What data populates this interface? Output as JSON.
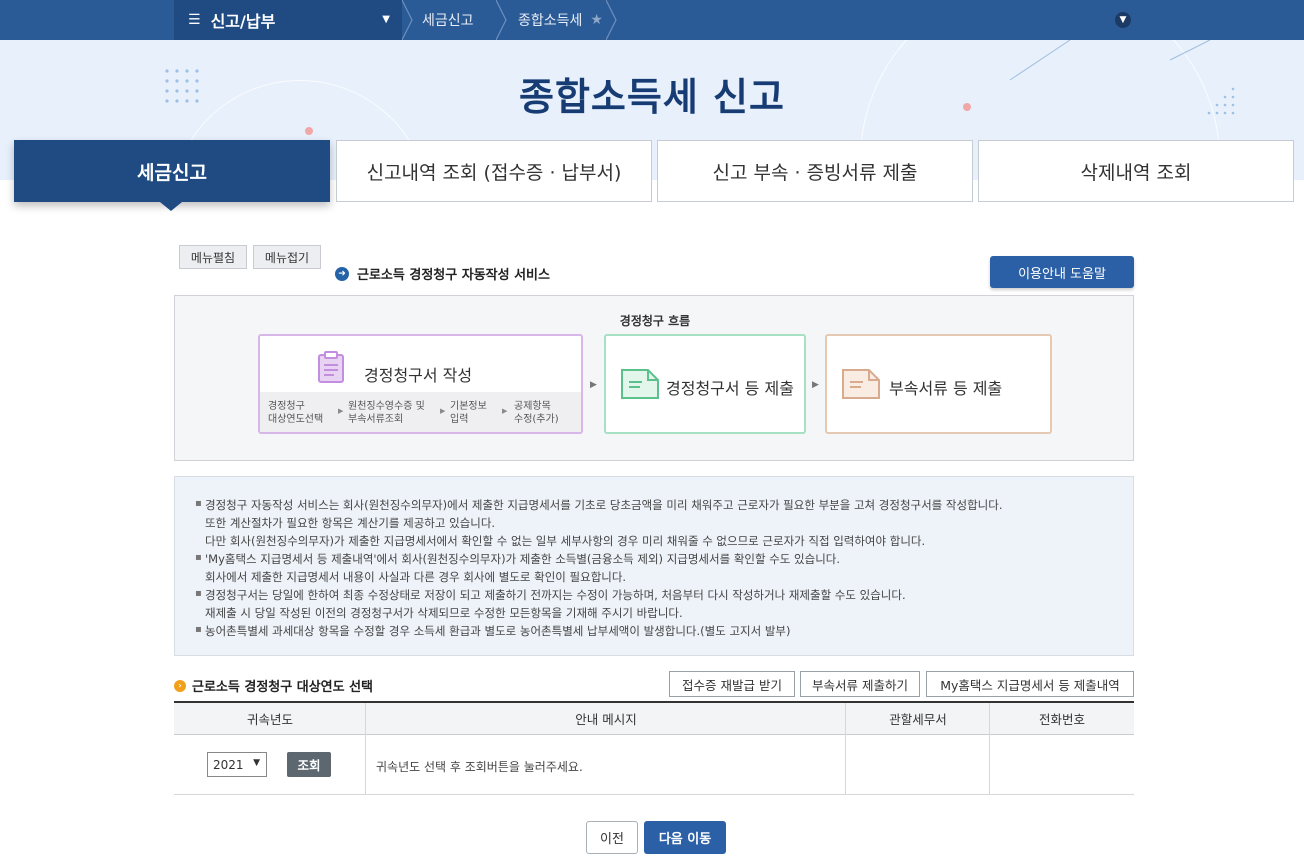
{
  "topnav": {
    "menu_label": "신고/납부",
    "breadcrumbs": [
      "세금신고",
      "종합소득세"
    ]
  },
  "page_title": "종합소득세 신고",
  "tabs": [
    {
      "label": "세금신고",
      "active": true
    },
    {
      "label": "신고내역 조회 (접수증 · 납부서)",
      "active": false
    },
    {
      "label": "신고 부속 · 증빙서류 제출",
      "active": false
    },
    {
      "label": "삭제내역 조회",
      "active": false
    }
  ],
  "menu_buttons": {
    "expand": "메뉴펼침",
    "collapse": "메뉴접기"
  },
  "service_title": "근로소득 경정청구 자동작성 서비스",
  "help_button": "이용안내 도움말",
  "flow": {
    "title": "경정청구 흐름",
    "step1": {
      "label": "경정청구서 작성",
      "substeps": [
        [
          "경정청구",
          "대상연도선택"
        ],
        [
          "원천징수영수증 및",
          "부속서류조회"
        ],
        [
          "기본정보",
          "입력"
        ],
        [
          "공제항목",
          "수정(추가)"
        ]
      ]
    },
    "step2": {
      "label": "경정청구서 등 제출"
    },
    "step3": {
      "label": "부속서류 등 제출"
    }
  },
  "info": {
    "lines": [
      {
        "bullet": true,
        "text": "경정청구 자동작성 서비스는 회사(원천징수의무자)에서 제출한 지급명세서를 기초로 당초금액을 미리 채워주고 근로자가 필요한 부분을 고쳐 경정청구서를 작성합니다."
      },
      {
        "bullet": false,
        "text": "또한 계산절차가 필요한 항목은 계산기를 제공하고 있습니다."
      },
      {
        "bullet": false,
        "text": "다만 회사(원천징수의무자)가 제출한 지급명세서에서 확인할 수 없는 일부 세부사항의 경우 미리 채워줄 수 없으므로 근로자가 직접 입력하여야 합니다."
      },
      {
        "bullet": true,
        "text": "'My홈택스 지급명세서 등 제출내역'에서 회사(원천징수의무자)가 제출한 소득별(금융소득 제외) 지급명세서를 확인할 수도 있습니다."
      },
      {
        "bullet": false,
        "text": "회사에서 제출한 지급명세서 내용이 사실과 다른 경우 회사에 별도로 확인이 필요합니다."
      },
      {
        "bullet": true,
        "text": "경정청구서는 당일에 한하여 최종 수정상태로 저장이 되고 제출하기 전까지는 수정이 가능하며, 처음부터 다시 작성하거나 재제출할 수도 있습니다."
      },
      {
        "bullet": false,
        "text": "재제출 시 당일 작성된 이전의 경정청구서가 삭제되므로 수정한 모든항목을 기재해 주시기 바랍니다."
      },
      {
        "bullet": true,
        "text": "농어촌특별세 과세대상 항목을 수정할 경우 소득세 환급과 별도로 농어촌특별세 납부세액이 발생합니다.(별도 고지서 발부)"
      }
    ]
  },
  "year_section": {
    "title": "근로소득 경정청구 대상연도 선택",
    "buttons": [
      "접수증 재발급 받기",
      "부속서류 제출하기",
      "My홈택스 지급명세서 등 제출내역"
    ]
  },
  "table": {
    "headers": [
      "귀속년도",
      "안내 메시지",
      "관할세무서",
      "전화번호"
    ],
    "row": {
      "year_selected": "2021",
      "search_button": "조회",
      "message": "귀속년도 선택 후 조회버튼을 눌러주세요.",
      "tax_office": "",
      "phone": ""
    }
  },
  "footer_buttons": {
    "prev": "이전",
    "next": "다음 이동"
  },
  "colors": {
    "nav": "#2b5b97",
    "primary": "#1f4a82",
    "accent": "#2b60a6",
    "band": "#e7f0fb"
  }
}
